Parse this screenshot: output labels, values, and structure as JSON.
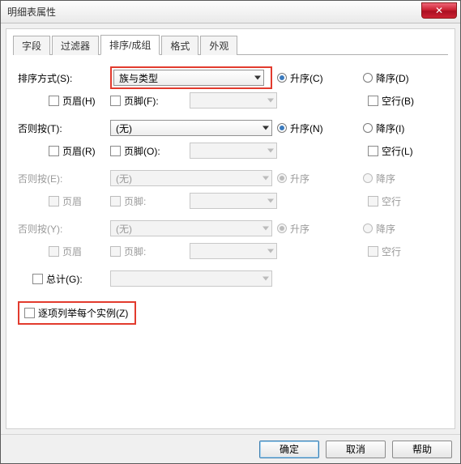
{
  "window": {
    "title": "明细表属性"
  },
  "tabs": [
    "字段",
    "过滤器",
    "排序/成组",
    "格式",
    "外观"
  ],
  "active_tab": 2,
  "labels": {
    "sort_by": "排序方式(S):",
    "then_by_t": "否则按(T):",
    "then_by_e": "否则按(E):",
    "then_by_y": "否则按(Y):",
    "header_h": "页眉(H)",
    "footer_f": "页脚(F):",
    "header_r": "页眉(R)",
    "footer_o": "页脚(O):",
    "header_3": "页眉",
    "footer_3": "页脚:",
    "header_4": "页眉",
    "footer_4": "页脚:",
    "asc_c": "升序(C)",
    "desc_d": "降序(D)",
    "blank_b": "空行(B)",
    "asc_n": "升序(N)",
    "desc_i": "降序(I)",
    "blank_l": "空行(L)",
    "asc_3": "升序",
    "desc_3": "降序",
    "blank_3": "空行",
    "asc_4": "升序",
    "desc_4": "降序",
    "blank_4": "空行",
    "grand_total": "总计(G):",
    "itemize": "逐项列举每个实例(Z)"
  },
  "combos": {
    "sort_by": "族与类型",
    "then_by_t": "(无)",
    "then_by_e": "(无)",
    "then_by_y": "(无)"
  },
  "buttons": {
    "ok": "确定",
    "cancel": "取消",
    "help": "帮助"
  }
}
